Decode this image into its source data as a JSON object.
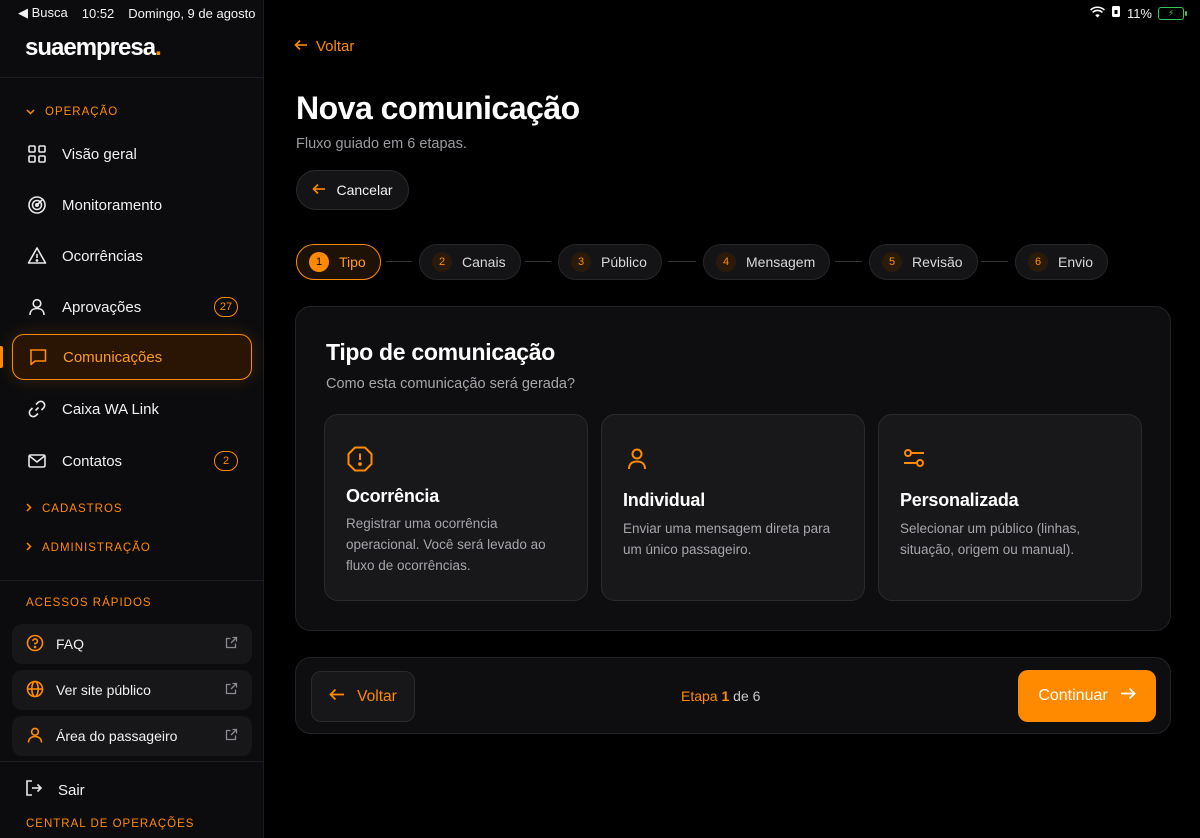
{
  "status_bar": {
    "back_app": "◀ Busca",
    "time": "10:52",
    "date": "Domingo, 9 de agosto",
    "battery": "11%"
  },
  "brand": {
    "name": "suaempresa",
    "dot": "."
  },
  "sidebar": {
    "operacao_label": "OPERAÇÃO",
    "items": [
      {
        "label": "Visão geral"
      },
      {
        "label": "Monitoramento"
      },
      {
        "label": "Ocorrências"
      },
      {
        "label": "Aprovações",
        "badge": "27"
      },
      {
        "label": "Comunicações"
      },
      {
        "label": "Caixa WA Link"
      },
      {
        "label": "Contatos",
        "badge": "2"
      }
    ],
    "cadastros_label": "CADASTROS",
    "administracao_label": "ADMINISTRAÇÃO",
    "quick_access_label": "ACESSOS RÁPIDOS",
    "quick_items": [
      {
        "label": "FAQ"
      },
      {
        "label": "Ver site público"
      },
      {
        "label": "Área do passageiro"
      }
    ],
    "logout_label": "Sair",
    "footer_label": "CENTRAL DE OPERAÇÕES"
  },
  "main": {
    "back_label": "Voltar",
    "title": "Nova comunicação",
    "subtitle": "Fluxo guiado em 6 etapas.",
    "cancel_label": "Cancelar",
    "steps": [
      {
        "num": "1",
        "label": "Tipo"
      },
      {
        "num": "2",
        "label": "Canais"
      },
      {
        "num": "3",
        "label": "Público"
      },
      {
        "num": "4",
        "label": "Mensagem"
      },
      {
        "num": "5",
        "label": "Revisão"
      },
      {
        "num": "6",
        "label": "Envio"
      }
    ],
    "card": {
      "title": "Tipo de comunicação",
      "subtitle": "Como esta comunicação será gerada?",
      "options": [
        {
          "title": "Ocorrência",
          "desc": "Registrar uma ocorrência operacional. Você será levado ao fluxo de ocorrências.",
          "icon": "alert-octagon-icon"
        },
        {
          "title": "Individual",
          "desc": "Enviar uma mensagem direta para um único passageiro.",
          "icon": "user-icon"
        },
        {
          "title": "Personalizada",
          "desc": "Selecionar um público (linhas, situação, origem ou manual).",
          "icon": "sliders-icon"
        }
      ]
    },
    "footer": {
      "back_label": "Voltar",
      "step_prefix": "Etapa",
      "step_current": "1",
      "step_suffix": "de 6",
      "next_label": "Continuar"
    }
  },
  "colors": {
    "accent": "#ff8a00",
    "background": "#000000",
    "surface": "#0e0e10"
  }
}
